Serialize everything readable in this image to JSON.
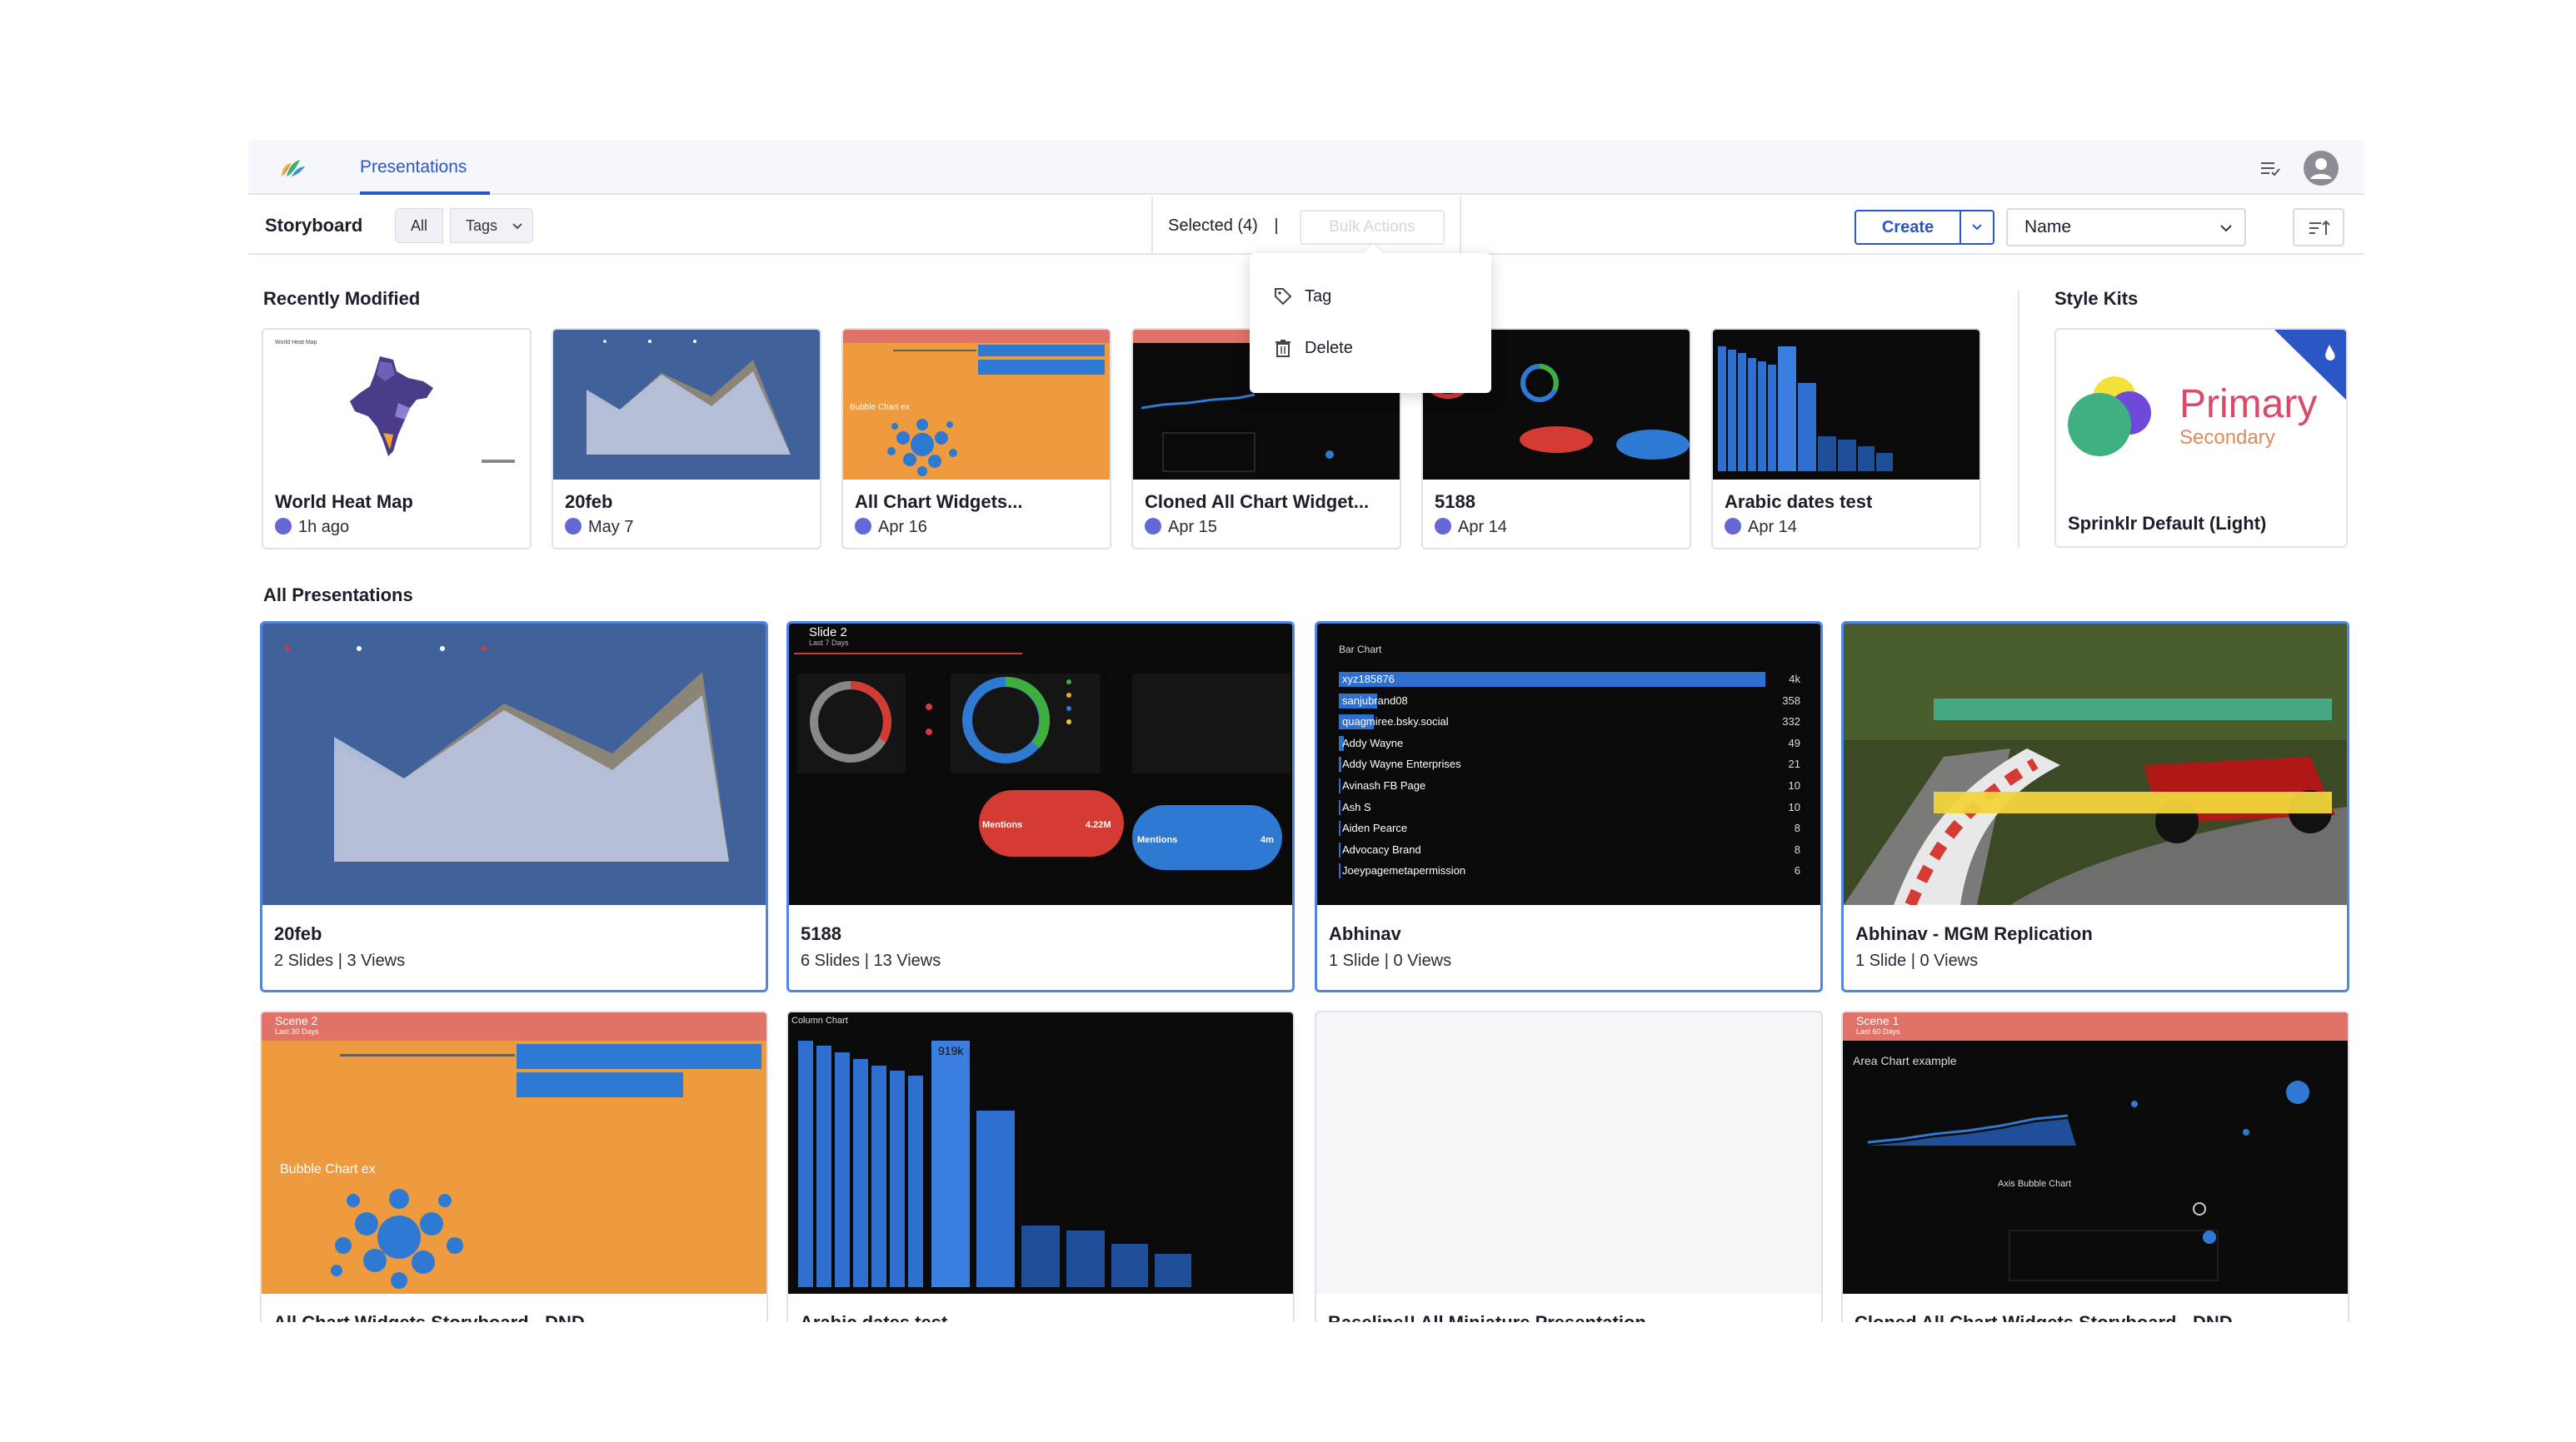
{
  "nav": {
    "tab": "Presentations"
  },
  "toolbar": {
    "title": "Storyboard",
    "filter_all": "All",
    "filter_tags": "Tags",
    "selected": "Selected (4)",
    "separator": "|",
    "bulk_actions": "Bulk Actions",
    "create": "Create",
    "sort_value": "Name"
  },
  "bulk_menu": {
    "tag": "Tag",
    "delete": "Delete"
  },
  "recent": {
    "title": "Recently Modified",
    "items": [
      {
        "name": "World Heat Map",
        "time": "1h ago",
        "thumb_label": "World Heat Map"
      },
      {
        "name": "20feb",
        "time": "May 7"
      },
      {
        "name": "All Chart Widgets...",
        "time": "Apr 16",
        "thumb_label": "Bubble Chart ex"
      },
      {
        "name": "Cloned All Chart Widget...",
        "time": "Apr 15"
      },
      {
        "name": "5188",
        "time": "Apr 14"
      },
      {
        "name": "Arabic dates test",
        "time": "Apr 14"
      }
    ]
  },
  "style_kits": {
    "title": "Style Kits",
    "primary": "Primary",
    "secondary": "Secondary",
    "name": "Sprinklr Default (Light)"
  },
  "all": {
    "title": "All Presentations",
    "items": [
      {
        "name": "20feb",
        "meta": "2 Slides | 3 Views"
      },
      {
        "name": "5188",
        "meta": "6 Slides | 13 Views",
        "slide": "Slide 2",
        "slide_sub": "Last 7 Days",
        "mentions": "Mentions",
        "mentions_value": "4.22M",
        "mentions2_value": "4m"
      },
      {
        "name": "Abhinav",
        "meta": "1 Slide | 0 Views",
        "chart_title": "Bar Chart"
      },
      {
        "name": "Abhinav - MGM Replication",
        "meta": "1 Slide | 0 Views"
      }
    ],
    "row2": [
      {
        "name": "All Chart Widgets Storyboard - DND",
        "scene": "Scene 2",
        "scene_sub": "Last 30 Days",
        "bubble": "Bubble Chart ex"
      },
      {
        "name": "Arabic dates test",
        "chart_title": "Column Chart",
        "peak": "919k"
      },
      {
        "name": "Baseline!! All Miniature Presentation"
      },
      {
        "name": "Cloned All Chart Widgets Storyboard - DND",
        "scene": "Scene 1",
        "scene_sub": "Last 60 Days",
        "area": "Area Chart example",
        "axis": "Axis Bubble Chart"
      }
    ]
  },
  "bar_rows": [
    {
      "label": "xyz185876",
      "value": "4k"
    },
    {
      "label": "sanjubrand08",
      "value": "358"
    },
    {
      "label": "quagmiree.bsky.social",
      "value": "332"
    },
    {
      "label": "Addy Wayne",
      "value": "49"
    },
    {
      "label": "Addy Wayne Enterprises",
      "value": "21"
    },
    {
      "label": "Avinash FB Page",
      "value": "10"
    },
    {
      "label": "Ash S",
      "value": "10"
    },
    {
      "label": "Aiden Pearce",
      "value": "8"
    },
    {
      "label": "Advocacy Brand",
      "value": "8"
    },
    {
      "label": "Joeypagemetapermission",
      "value": "6"
    }
  ],
  "colors": {
    "accent": "#2a56c6",
    "dot": "#6667d6",
    "selected_border": "#4f86e3"
  }
}
